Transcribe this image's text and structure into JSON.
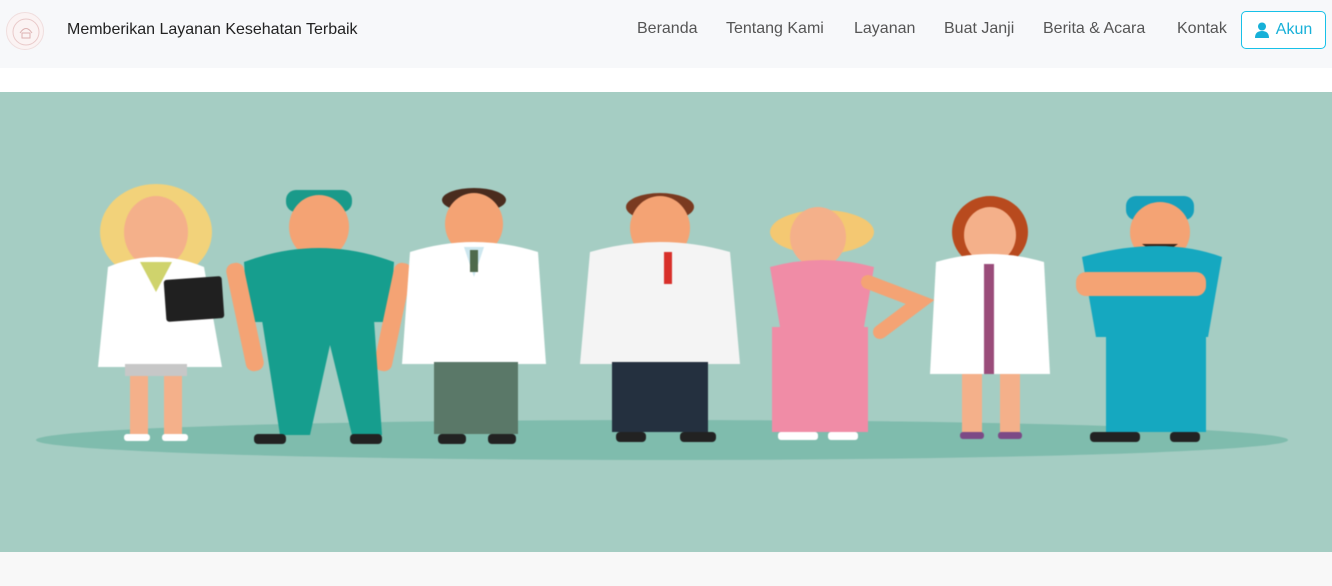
{
  "header": {
    "tagline": "Memberikan Layanan Kesehatan Terbaik",
    "logo_icon": "hospital-logo-icon"
  },
  "nav": {
    "items": [
      {
        "label": "Beranda"
      },
      {
        "label": "Tentang Kami"
      },
      {
        "label": "Layanan"
      },
      {
        "label": "Buat Janji"
      },
      {
        "label": "Berita & Acara"
      },
      {
        "label": "Kontak"
      }
    ],
    "account": {
      "label": "Akun",
      "icon": "user-icon"
    }
  },
  "hero": {
    "image": "medical-team-illustration",
    "colors": {
      "background": "#a5cdc3",
      "ground": "#7fbcad"
    }
  },
  "colors": {
    "accent": "#17c1e8",
    "navbar_bg": "#f7f8fa",
    "page_bg": "#f8f8f8"
  }
}
